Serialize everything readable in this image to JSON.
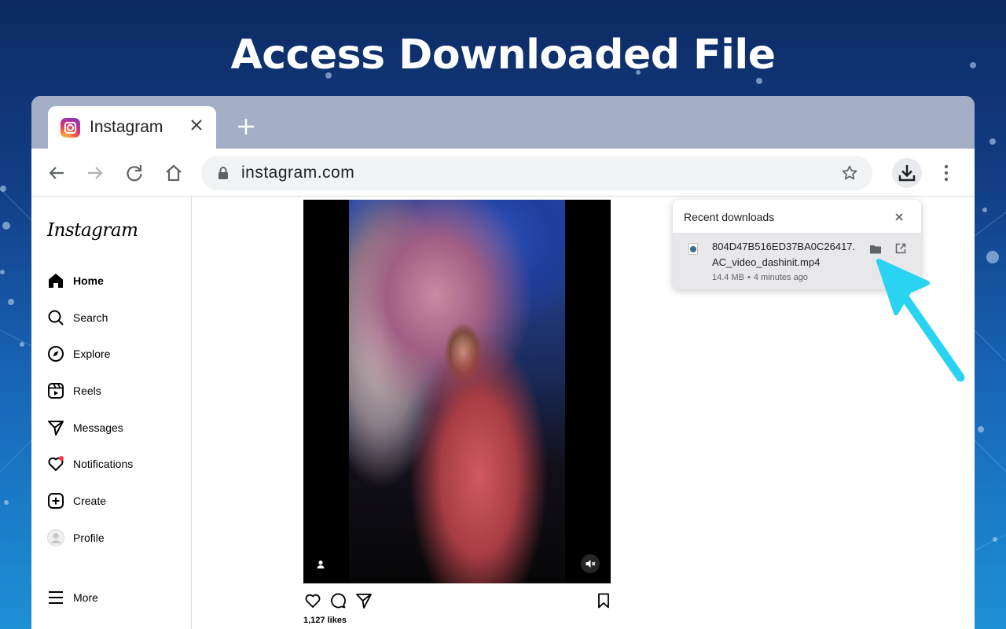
{
  "headline": "Access Downloaded File",
  "browser": {
    "tab": {
      "title": "Instagram",
      "close_icon": "close-icon",
      "favicon": "instagram-favicon"
    },
    "new_tab_icon": "plus-icon",
    "toolbar": {
      "back_icon": "arrow-left-icon",
      "forward_icon": "arrow-right-icon",
      "reload_icon": "reload-icon",
      "home_icon": "home-icon",
      "url": "instagram.com",
      "lock_icon": "lock-icon",
      "bookmark_icon": "star-icon",
      "downloads_icon": "download-icon",
      "menu_icon": "kebab-menu-icon"
    }
  },
  "instagram": {
    "logo": "Instagram",
    "nav": [
      {
        "label": "Home",
        "icon": "home-filled-icon",
        "active": true
      },
      {
        "label": "Search",
        "icon": "search-icon"
      },
      {
        "label": "Explore",
        "icon": "compass-icon"
      },
      {
        "label": "Reels",
        "icon": "reels-icon"
      },
      {
        "label": "Messages",
        "icon": "send-icon"
      },
      {
        "label": "Notifications",
        "icon": "heart-icon"
      },
      {
        "label": "Create",
        "icon": "plus-square-icon"
      },
      {
        "label": "Profile",
        "icon": "avatar-icon"
      },
      {
        "label": "More",
        "icon": "hamburger-icon"
      }
    ],
    "post": {
      "likes": "1,127 likes"
    }
  },
  "downloads_popup": {
    "title": "Recent downloads",
    "items": [
      {
        "filename_line1": "804D47B516ED37BA0C26417.",
        "filename_line2": "AC_video_dashinit.mp4",
        "size": "14.4 MB",
        "separator": "•",
        "time": "4 minutes ago"
      }
    ]
  },
  "colors": {
    "accent_arrow": "#2bd3f2",
    "tab_strip": "#a4aec6",
    "background_top": "#0d2a63",
    "background_bottom": "#1d90d6"
  }
}
